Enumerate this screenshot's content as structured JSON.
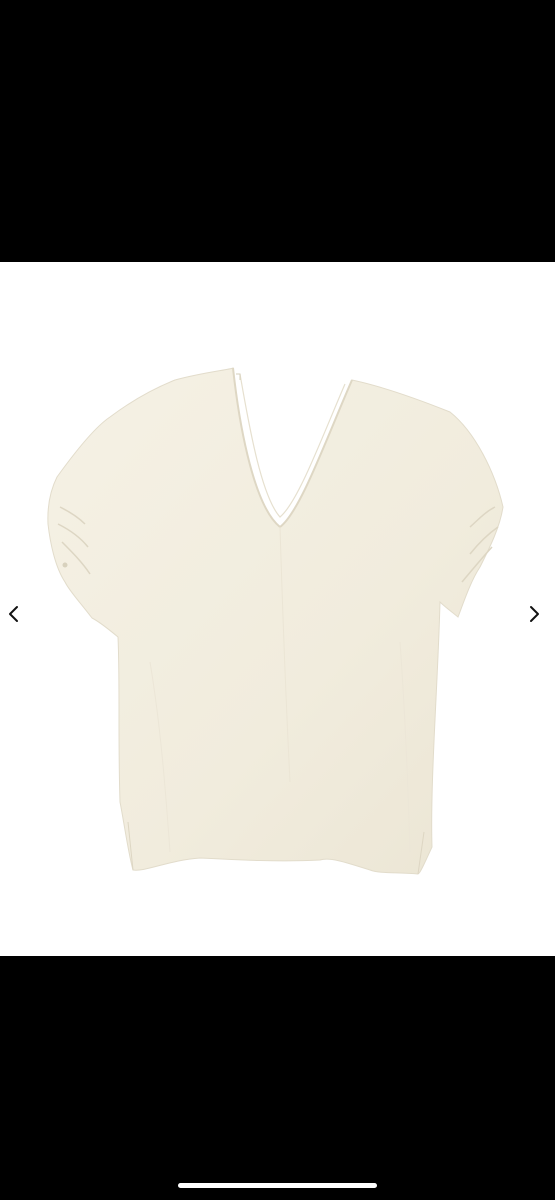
{
  "viewer": {
    "background_color": "#000000",
    "frame_color": "#ffffff",
    "garment_color": "#f3efe2",
    "garment_shadow_color": "#e4dfcf",
    "prev_icon": "chevron-left-icon",
    "next_icon": "chevron-right-icon",
    "arrow_color": "#111111"
  }
}
